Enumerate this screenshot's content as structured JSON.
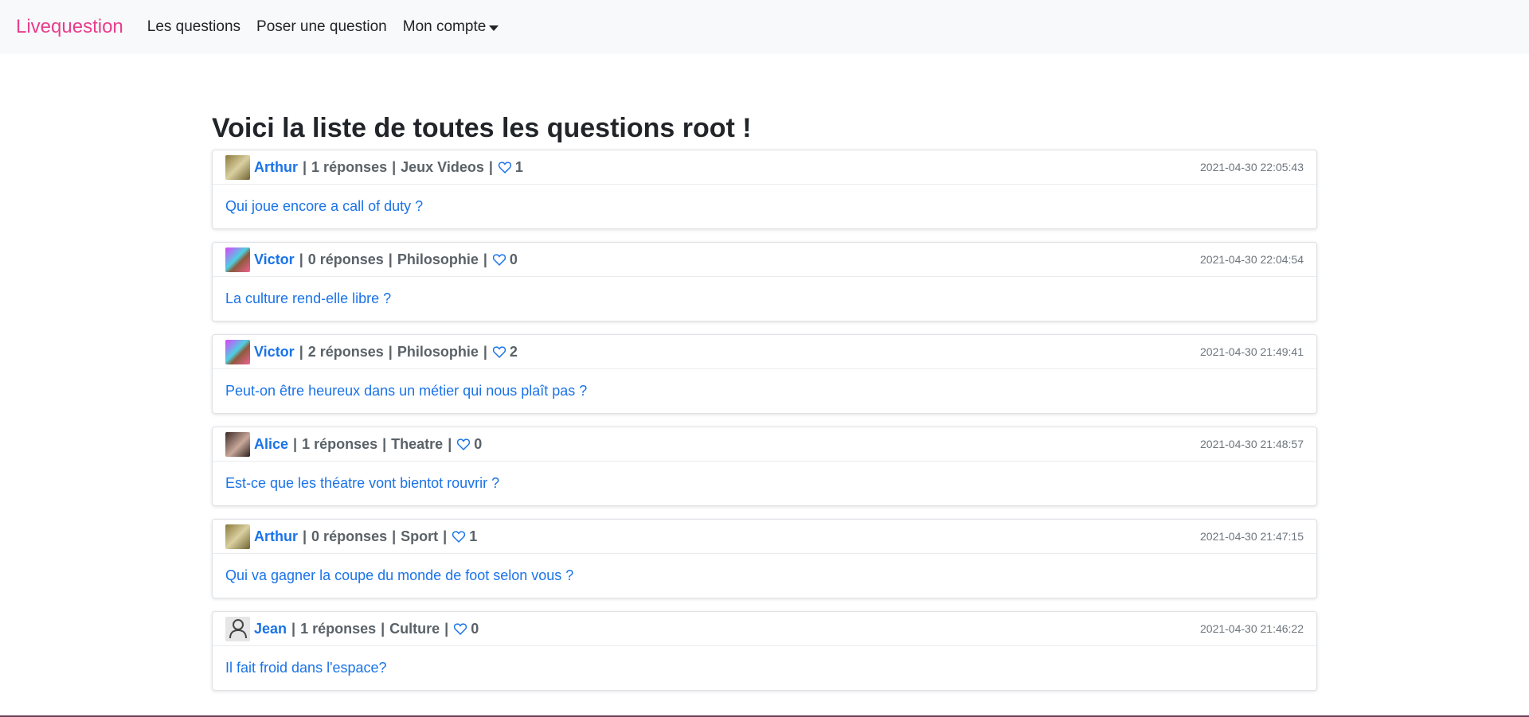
{
  "navbar": {
    "brand": "Livequestion",
    "links": [
      "Les questions",
      "Poser une question",
      "Mon compte"
    ],
    "brand_color": "#e83e8c"
  },
  "page_title": "Voici la liste de toutes les questions root !",
  "separator": "|",
  "questions": [
    {
      "author": "Arthur",
      "answers": "1 réponses",
      "category": "Jeux Videos",
      "likes": "1",
      "date": "2021-04-30 22:05:43",
      "question": "Qui joue encore a call of duty ?"
    },
    {
      "author": "Victor",
      "answers": "0 réponses",
      "category": "Philosophie",
      "likes": "0",
      "date": "2021-04-30 22:04:54",
      "question": "La culture rend-elle libre ?"
    },
    {
      "author": "Victor",
      "answers": "2 réponses",
      "category": "Philosophie",
      "likes": "2",
      "date": "2021-04-30 21:49:41",
      "question": "Peut-on être heureux dans un métier qui nous plaît pas ?"
    },
    {
      "author": "Alice",
      "answers": "1 réponses",
      "category": "Theatre",
      "likes": "0",
      "date": "2021-04-30 21:48:57",
      "question": "Est-ce que les théatre vont bientot rouvrir ?"
    },
    {
      "author": "Arthur",
      "answers": "0 réponses",
      "category": "Sport",
      "likes": "1",
      "date": "2021-04-30 21:47:15",
      "question": "Qui va gagner la coupe du monde de foot selon vous ?"
    },
    {
      "author": "Jean",
      "answers": "1 réponses",
      "category": "Culture",
      "likes": "0",
      "date": "2021-04-30 21:46:22",
      "question": "Il fait froid dans l'espace?"
    }
  ],
  "icons": {
    "like": "heart-icon",
    "menu_caret": "caret-down-icon",
    "default_avatar": "user-icon"
  },
  "colors": {
    "link": "#1a73e8",
    "meta": "#5a6268",
    "navbar_bg": "#f8f9fa"
  }
}
